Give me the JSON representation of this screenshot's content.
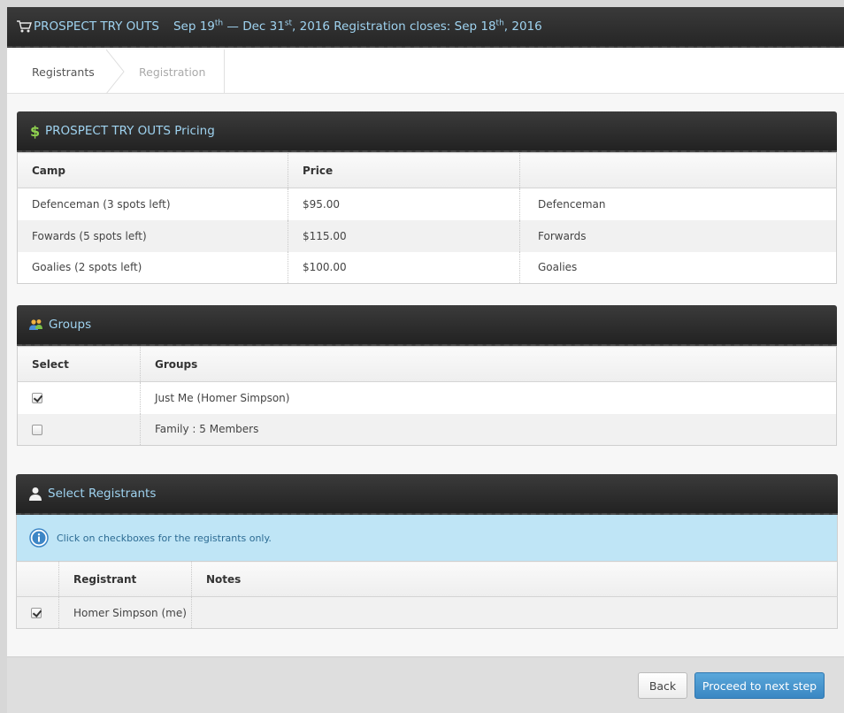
{
  "header": {
    "event_name": "PROSPECT TRY OUTS",
    "date_start": "Sep 19",
    "date_start_sup": "th",
    "date_sep": " — Dec 31",
    "date_end_sup": "st",
    "date_year": ", 2016 Registration closes: Sep 18",
    "closes_sup": "th",
    "closes_year": ", 2016",
    "icon": "cart-icon"
  },
  "steps": {
    "step1": "Registrants",
    "step2": "Registration"
  },
  "pricing": {
    "title": "PROSPECT TRY OUTS Pricing",
    "icon": "dollar-icon",
    "columns": [
      "Camp",
      "Price",
      ""
    ],
    "rows": [
      {
        "camp": "Defenceman (3 spots left)",
        "price": "$95.00",
        "name": "Defenceman"
      },
      {
        "camp": "Fowards (5 spots left)",
        "price": "$115.00",
        "name": "Forwards"
      },
      {
        "camp": "Goalies (2 spots left)",
        "price": "$100.00",
        "name": "Goalies"
      }
    ]
  },
  "groups": {
    "title": "Groups",
    "icon": "people-icon",
    "columns": [
      "Select",
      "Groups"
    ],
    "rows": [
      {
        "checked": true,
        "label": "Just Me (Homer Simpson)"
      },
      {
        "checked": false,
        "label": "Family : 5 Members"
      }
    ]
  },
  "registrants": {
    "title": "Select Registrants",
    "icon": "user-icon",
    "info": "Click on checkboxes for the registrants only.",
    "columns": [
      "",
      "Registrant",
      "Notes"
    ],
    "rows": [
      {
        "checked": true,
        "name": "Homer Simpson (me)",
        "notes": ""
      }
    ]
  },
  "footer": {
    "back_label": "Back",
    "next_label": "Proceed to next step"
  },
  "colors": {
    "header_text": "#9fd3f0",
    "info_bg": "#bfe5f6",
    "primary_button": "#3a87c3"
  }
}
